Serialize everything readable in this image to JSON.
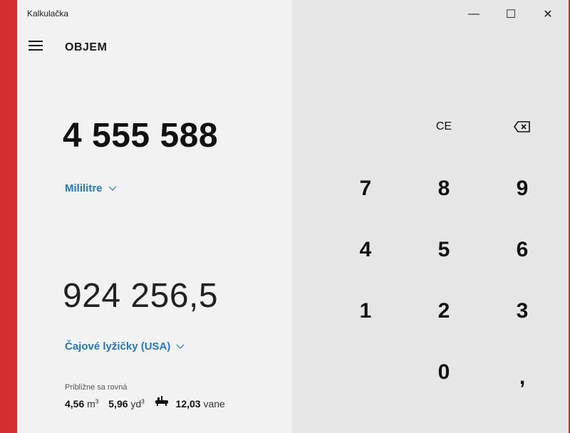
{
  "window": {
    "title": "Kalkulačka",
    "controls": {
      "minimize": "—",
      "maximize": "☐",
      "close": "✕"
    }
  },
  "header": {
    "mode": "OBJEM"
  },
  "input": {
    "value": "4 555 588",
    "unit": "Mililitre",
    "unit_dropdown_icon": "chevron-down-icon"
  },
  "output": {
    "value": "924 256,5",
    "unit": "Čajové lyžičky (USA)",
    "unit_dropdown_icon": "chevron-down-icon"
  },
  "approx": {
    "label": "Približne sa rovná",
    "items": [
      {
        "value": "4,56",
        "unit": "m",
        "exp": "3"
      },
      {
        "value": "5,96",
        "unit": "yd",
        "exp": "3"
      },
      {
        "value": "12,03",
        "unit": "vane",
        "icon": "bathtub-icon"
      }
    ]
  },
  "keypad": {
    "ce": "CE",
    "backspace_icon": "backspace-icon",
    "rows": [
      [
        "7",
        "8",
        "9"
      ],
      [
        "4",
        "5",
        "6"
      ],
      [
        "1",
        "2",
        "3"
      ]
    ],
    "zero": "0",
    "decimal": ","
  },
  "colors": {
    "accent": "#1f78c8",
    "window_border": "#d32f2f"
  }
}
